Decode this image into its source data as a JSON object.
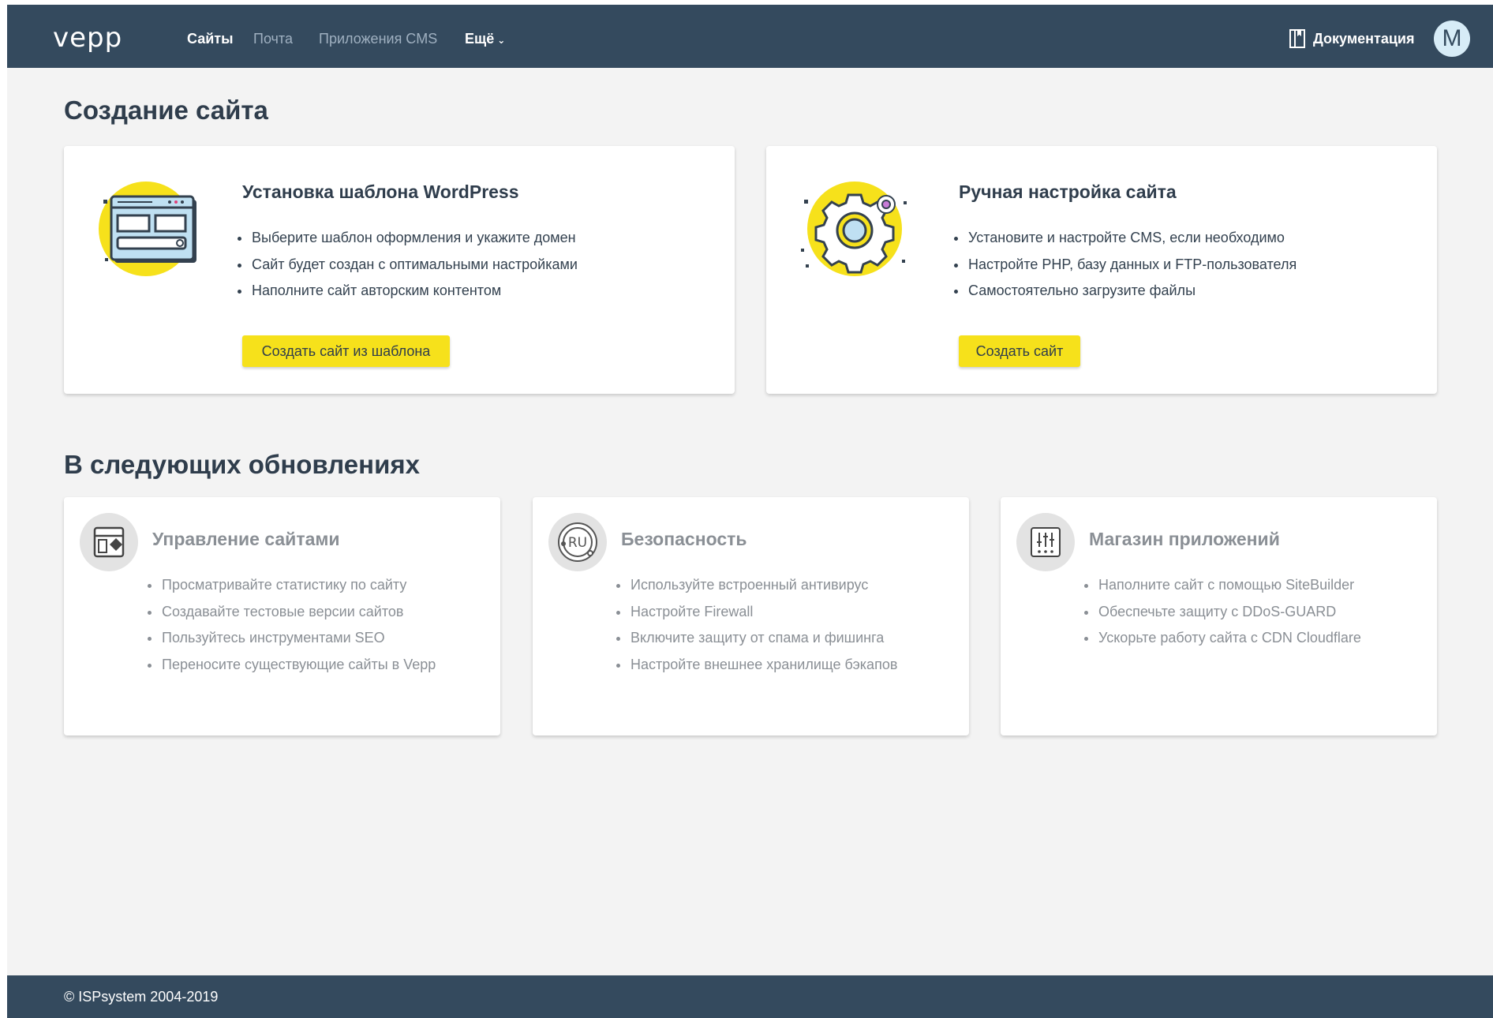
{
  "header": {
    "logo": "vepp",
    "nav": [
      "Сайты",
      "Почта",
      "Приложения CMS",
      "Ещё"
    ],
    "docs_label": "Документация",
    "avatar_letter": "M"
  },
  "create_section": {
    "title": "Создание сайта",
    "cards": [
      {
        "title": "Установка шаблона WordPress",
        "items": [
          "Выберите шаблон оформления и укажите домен",
          "Сайт будет создан с оптимальными настройками",
          "Наполните сайт авторским контентом"
        ],
        "button": "Создать сайт из шаблона",
        "icon": "browser-template-icon"
      },
      {
        "title": "Ручная настройка сайта",
        "items": [
          "Установите и настройте CMS, если необходимо",
          "Настройте PHP, базу данных и FTP-пользователя",
          "Самостоятельно загрузите файлы"
        ],
        "button": "Создать сайт",
        "icon": "gears-icon"
      }
    ]
  },
  "upcoming_section": {
    "title": "В следующих обновлениях",
    "cards": [
      {
        "title": "Управление сайтами",
        "items": [
          "Просматривайте статистику по сайту",
          "Создавайте тестовые версии сайтов",
          "Пользуйтесь инструментами SEO",
          "Переносите существующие сайты в Vepp"
        ],
        "icon": "site-management-icon"
      },
      {
        "title": "Безопасность",
        "items": [
          "Используйте встроенный антивирус",
          "Настройте Firewall",
          "Включите защиту от спама и фишинга",
          "Настройте внешнее хранилище бэкапов"
        ],
        "icon": "ru-shield-icon"
      },
      {
        "title": "Магазин приложений",
        "items": [
          "Наполните сайт с помощью SiteBuilder",
          "Обеспечьте защиту с DDoS-GUARD",
          "Ускорьте работу сайта с CDN Cloudflare"
        ],
        "icon": "sliders-icon"
      }
    ]
  },
  "footer": {
    "copyright": "© ISPsystem 2004-2019"
  },
  "colors": {
    "header_bg": "#344a5e",
    "accent_button": "#f6e11b",
    "page_bg": "#f3f3f3"
  }
}
